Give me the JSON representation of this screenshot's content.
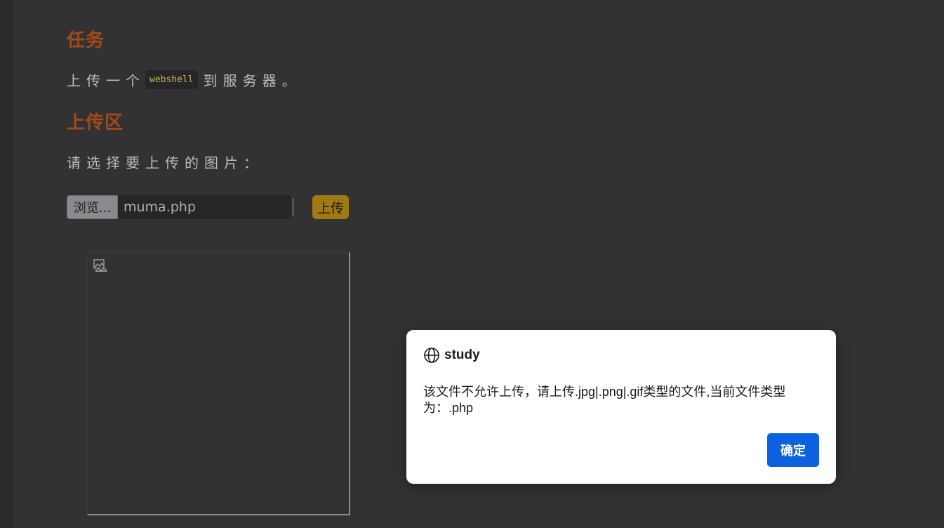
{
  "page": {
    "task_heading": "任务",
    "task_text_before": "上传一个",
    "task_code": "webshell",
    "task_text_after": "到服务器。",
    "upload_heading": "上传区",
    "choose_label": "请选择要上传的图片："
  },
  "upload_form": {
    "browse_label": "浏览...",
    "selected_file": "muma.php",
    "submit_label": "上传"
  },
  "preview": {
    "image_state": "broken-image-icon"
  },
  "dialog": {
    "site": "study",
    "message": "该文件不允许上传，请上传.jpg|.png|.gif类型的文件,当前文件类型为：.php",
    "ok_label": "确定"
  },
  "colors": {
    "background": "#323234",
    "heading": "#a44a17",
    "upload_button": "#a07a12",
    "dialog_button": "#0b61e0"
  }
}
